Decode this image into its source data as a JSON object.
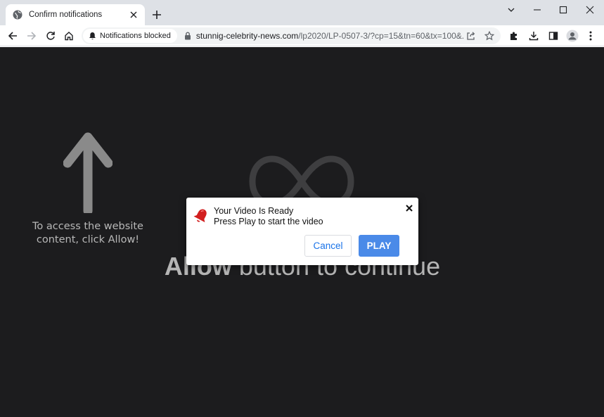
{
  "browser": {
    "tab": {
      "title": "Confirm notifications",
      "favicon": "globe-icon"
    },
    "toolbar": {
      "notification_chip": "Notifications blocked",
      "url_host": "stunnig-celebrity-news.com",
      "url_path": "/lp2020/LP-0507-3/?cp=15&tn=60&tx=100&..."
    },
    "colors": {
      "tabstrip": "#dee1e6",
      "omnibox": "#f1f3f4"
    }
  },
  "page": {
    "hint": "To access the website content, click Allow!",
    "background_message_bold": "Allow",
    "background_message_rest": " button to continue",
    "colors": {
      "background": "#1c1c1e",
      "text": "#b5b5b5"
    }
  },
  "dialog": {
    "title": "Your Video Is Ready",
    "subtitle": "Press Play to start the video",
    "cancel_label": "Cancel",
    "play_label": "PLAY",
    "icon": "red-bell-icon",
    "colors": {
      "play_button": "#4a8ae8",
      "cancel_text": "#1a73e8"
    }
  }
}
